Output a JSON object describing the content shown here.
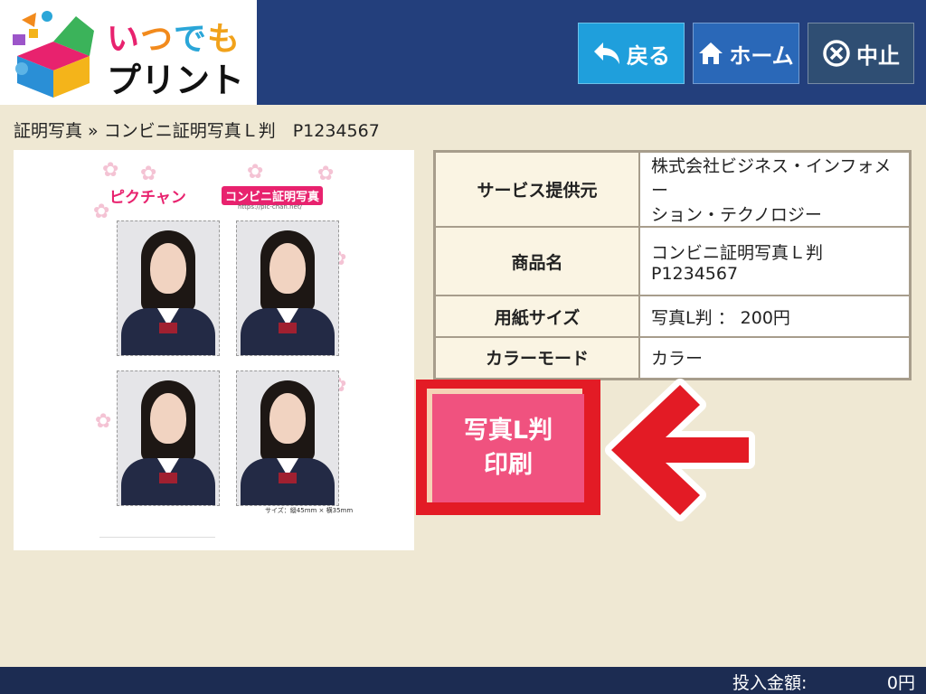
{
  "logo": {
    "line1": [
      "い",
      "つ",
      "で",
      "も"
    ],
    "line2": "プリント"
  },
  "header": {
    "back_label": "戻る",
    "home_label": "ホーム",
    "stop_label": "中止",
    "icons": {
      "back": "back-arrow-icon",
      "home": "home-icon",
      "stop": "cancel-circle-icon"
    }
  },
  "breadcrumb": "証明写真 » コンビニ証明写真Ｌ判　P1234567",
  "preview": {
    "brand": "ピクチャン",
    "title": "コンビニ証明写真",
    "url": "https://pic-chan.net/",
    "size_note": "サイズ：縦45mm × 横35mm"
  },
  "info": {
    "rows": [
      {
        "key": "サービス提供元",
        "value_lines": [
          "株式会社ビジネス・インフォメー",
          "ション・テクノロジー"
        ]
      },
      {
        "key": "商品名",
        "value_lines": [
          "コンビニ証明写真Ｌ判",
          "P1234567"
        ]
      },
      {
        "key": "用紙サイズ",
        "value_lines": [
          "写真L判 ： 200円"
        ]
      },
      {
        "key": "カラーモード",
        "value_lines": [
          "カラー"
        ]
      }
    ]
  },
  "print_button": {
    "line1": "写真L判",
    "line2": "印刷"
  },
  "footer": {
    "amount_label": "投入金額:",
    "amount_value": "0円"
  },
  "colors": {
    "background": "#efe8d3",
    "header": "#233f7c",
    "back_button": "#1f9fdc",
    "home_button": "#2a68b8",
    "stop_button": "#2f4e73",
    "print_button": "#f0527f",
    "highlight": "#e31b25",
    "footer": "#1c2c52"
  }
}
